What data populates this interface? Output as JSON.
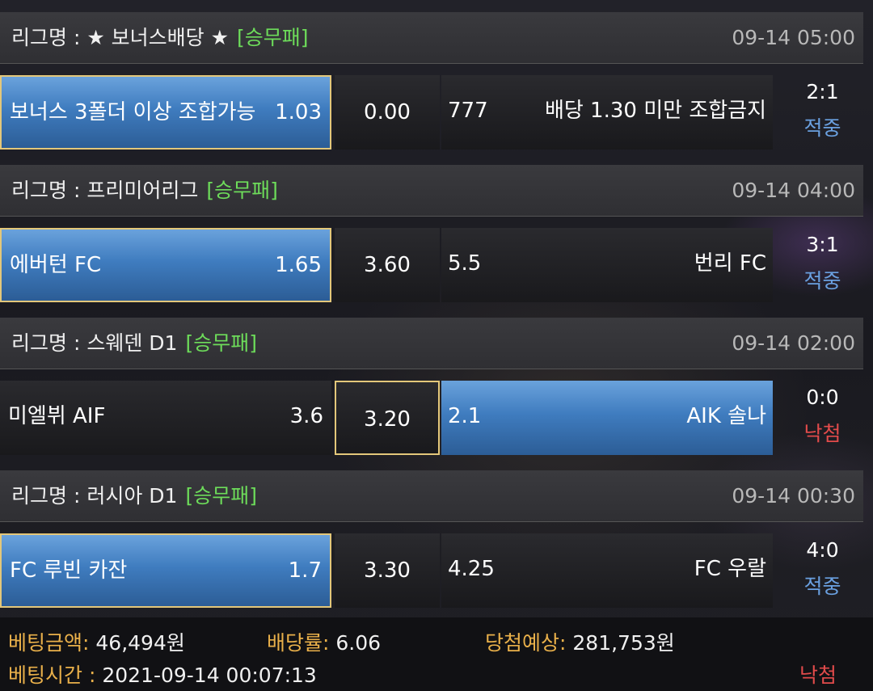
{
  "league_prefix": "리그명 : ",
  "bets": [
    {
      "league": "★ 보너스배당 ★",
      "type": "[승무패]",
      "time": "09-14 05:00",
      "home_name": "보너스 3폴더 이상 조합가능",
      "home_odd": "1.03",
      "draw_odd": "0.00",
      "away_odd": "777",
      "away_name": "배당 1.30 미만 조합금지",
      "selected": "home",
      "score": "2:1",
      "status": "적중"
    },
    {
      "league": "프리미어리그",
      "type": "[승무패]",
      "time": "09-14 04:00",
      "home_name": "에버턴 FC",
      "home_odd": "1.65",
      "draw_odd": "3.60",
      "away_odd": "5.5",
      "away_name": "번리 FC",
      "selected": "home",
      "score": "3:1",
      "status": "적중"
    },
    {
      "league": "스웨덴 D1",
      "type": "[승무패]",
      "time": "09-14 02:00",
      "home_name": "미엘뷔 AIF",
      "home_odd": "3.6",
      "draw_odd": "3.20",
      "away_odd": "2.1",
      "away_name": "AIK 솔나",
      "selected": "away",
      "draw_outlined": true,
      "score": "0:0",
      "status": "낙첨"
    },
    {
      "league": "러시아 D1",
      "type": "[승무패]",
      "time": "09-14 00:30",
      "home_name": "FC 루빈 카잔",
      "home_odd": "1.7",
      "draw_odd": "3.30",
      "away_odd": "4.25",
      "away_name": "FC 우랄",
      "selected": "home",
      "score": "4:0",
      "status": "적중"
    }
  ],
  "summary": {
    "amount_label": "베팅금액:",
    "amount_value": " 46,494원",
    "rate_label": "배당률:",
    "rate_value": " 6.06",
    "expected_label": "당첨예상:",
    "expected_value": " 281,753원",
    "time_label": "베팅시간 :",
    "time_value": " 2021-09-14 00:07:13",
    "result": "낙첨"
  },
  "colors": {
    "hit": "#6aa0e0",
    "miss": "#e24b4b",
    "bet_type": "#6ddc5a",
    "footer_label": "#e9b04a"
  }
}
